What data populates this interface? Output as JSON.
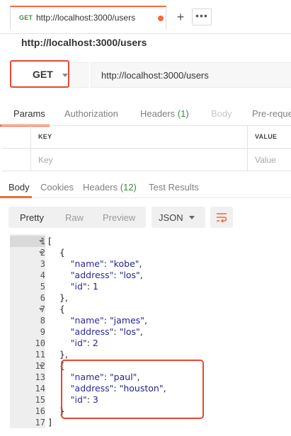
{
  "tab": {
    "method": "GET",
    "url": "http://localhost:3000/users",
    "add_label": "+",
    "more_label": "•••"
  },
  "request": {
    "title": "http://localhost:3000/users",
    "method": "GET",
    "url": "http://localhost:3000/users"
  },
  "request_tabs": {
    "params": "Params",
    "authorization": "Authorization",
    "headers": "Headers",
    "headers_count": "(1)",
    "body": "Body",
    "prerequest": "Pre-reque"
  },
  "params_table": {
    "key_header": "KEY",
    "value_header": "VALUE",
    "key_placeholder": "Key",
    "value_placeholder": "Value"
  },
  "response_tabs": {
    "body": "Body",
    "cookies": "Cookies",
    "headers": "Headers",
    "headers_count": "(12)",
    "test_results": "Test Results"
  },
  "view_modes": {
    "pretty": "Pretty",
    "raw": "Raw",
    "preview": "Preview",
    "format": "JSON"
  },
  "icons": {
    "wrap": "wrap-lines-icon",
    "fold": "fold-caret-icon"
  },
  "colors": {
    "accent": "#f26b3a",
    "highlight": "#e8472f",
    "method_green": "#3d8a3d"
  },
  "code_lines": [
    {
      "num": "1",
      "fold": true,
      "text": "["
    },
    {
      "num": "2",
      "fold": true,
      "text": "    {"
    },
    {
      "num": "3",
      "fold": false,
      "text": "        \"name\": \"kobe\","
    },
    {
      "num": "4",
      "fold": false,
      "text": "        \"address\": \"los\","
    },
    {
      "num": "5",
      "fold": false,
      "text": "        \"id\": 1"
    },
    {
      "num": "6",
      "fold": false,
      "text": "    },"
    },
    {
      "num": "7",
      "fold": true,
      "text": "    {"
    },
    {
      "num": "8",
      "fold": false,
      "text": "        \"name\": \"james\","
    },
    {
      "num": "9",
      "fold": false,
      "text": "        \"address\": \"los\","
    },
    {
      "num": "10",
      "fold": false,
      "text": "        \"id\": 2"
    },
    {
      "num": "11",
      "fold": false,
      "text": "    },"
    },
    {
      "num": "12",
      "fold": true,
      "text": "    {"
    },
    {
      "num": "13",
      "fold": false,
      "text": "        \"name\": \"paul\","
    },
    {
      "num": "14",
      "fold": false,
      "text": "        \"address\": \"houston\","
    },
    {
      "num": "15",
      "fold": false,
      "text": "        \"id\": 3"
    },
    {
      "num": "16",
      "fold": false,
      "text": "    }"
    },
    {
      "num": "17",
      "fold": false,
      "text": "]"
    }
  ]
}
